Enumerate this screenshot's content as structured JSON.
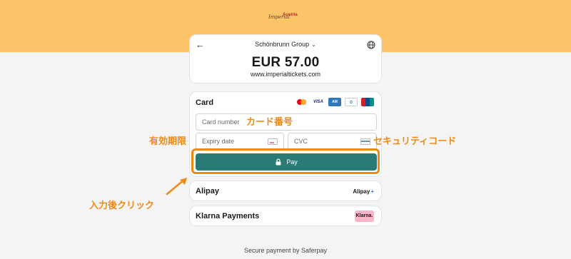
{
  "logo": {
    "script": "Imperial",
    "brand": "Austria"
  },
  "header": {
    "merchant": "Schönbrunn Group",
    "amount": "EUR 57.00",
    "site": "www.imperialtickets.com"
  },
  "card": {
    "title": "Card",
    "brands": [
      "mastercard",
      "VISA",
      "amex",
      "diners",
      "UnionPay"
    ],
    "number_placeholder": "Card number",
    "expiry_placeholder": "Expiry date",
    "cvc_placeholder": "CVC",
    "pay_label": "Pay"
  },
  "methods": [
    {
      "label": "Alipay",
      "logo": "Alipay"
    },
    {
      "label": "Klarna Payments",
      "logo": "Klarna."
    }
  ],
  "footer": "Secure payment by Saferpay",
  "annotations": {
    "card_number": "カード番号",
    "expiry": "有効期限",
    "cvc": "セキュリティコード",
    "click": "入力後クリック"
  },
  "colors": {
    "top_band": "#fcc56a",
    "pay_button": "#2a7a76",
    "annotation": "#f08a12"
  }
}
